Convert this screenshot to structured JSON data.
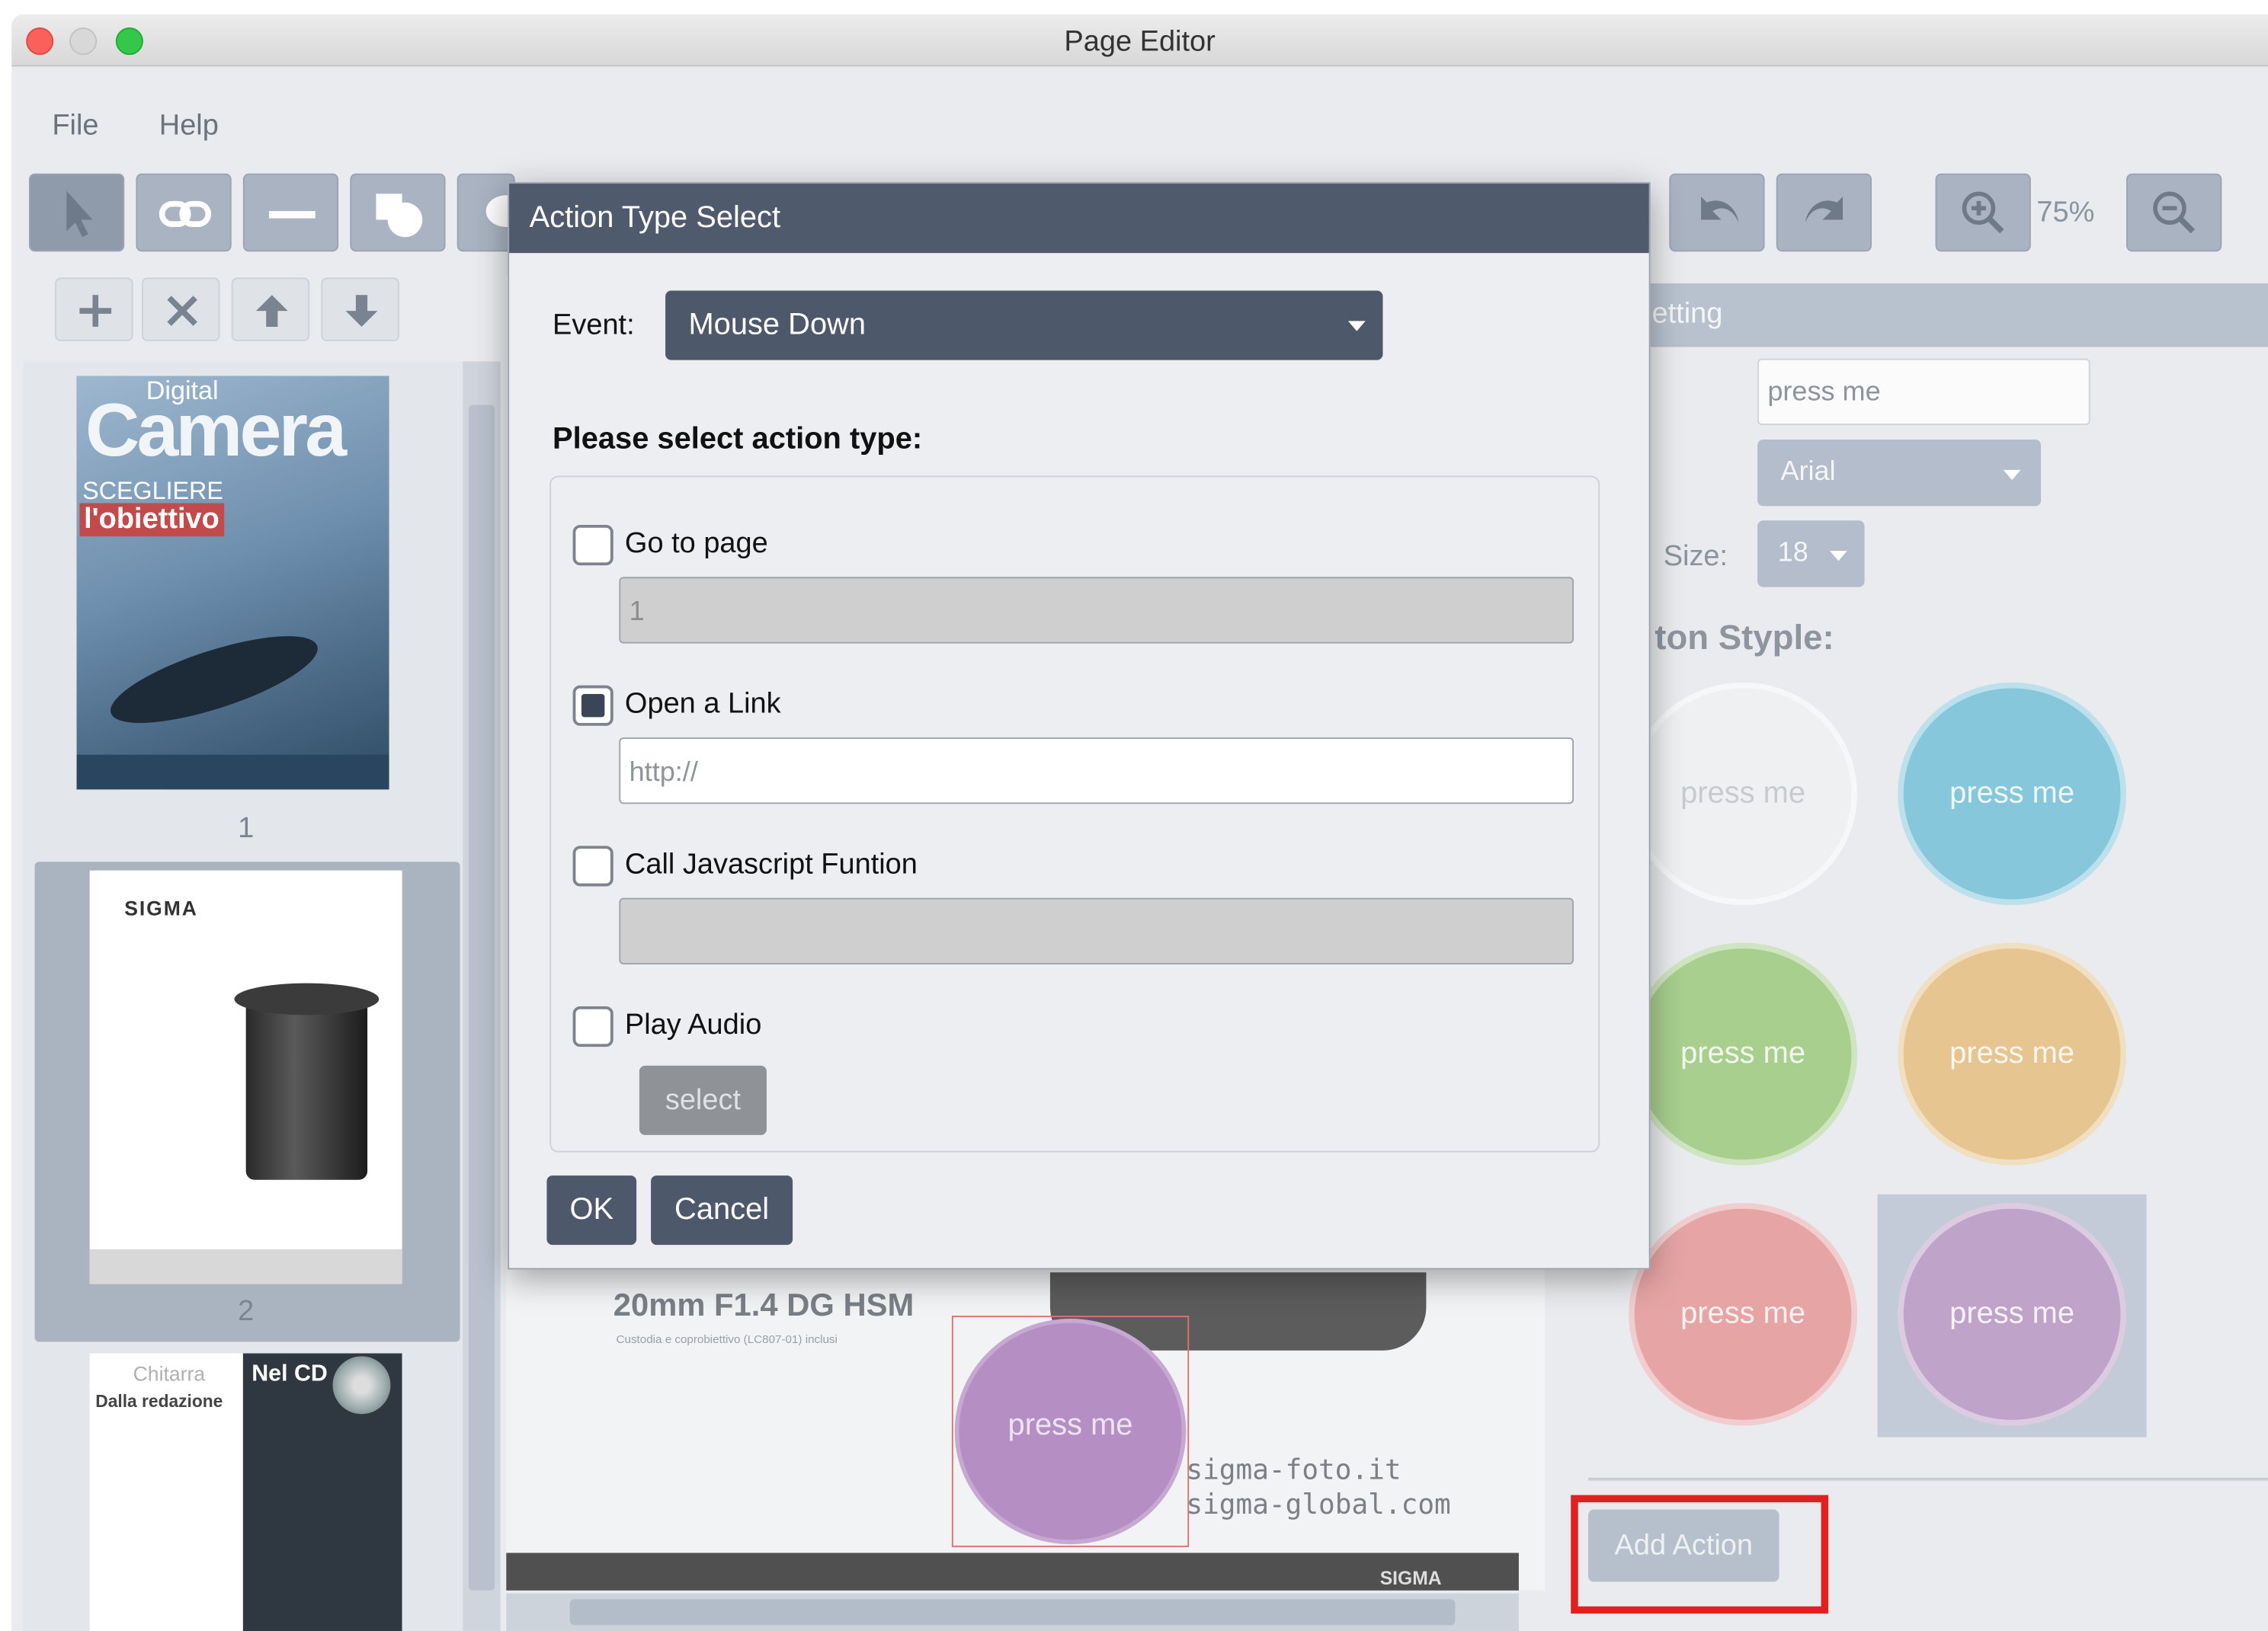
{
  "window": {
    "title": "Page Editor"
  },
  "menu": {
    "items": [
      "File",
      "Help"
    ]
  },
  "toolbar": {
    "zoom": "75%"
  },
  "pages": {
    "labels": [
      "1",
      "2"
    ],
    "page1": {
      "mag_title": "Camera",
      "mag_sub": "Digital",
      "headline1": "SCEGLIERE",
      "headline2": "l'obiettivo"
    },
    "page2": {
      "brand": "SIGMA"
    },
    "page3": {
      "left_title": "Chitarra",
      "left_sub": "Dalla redazione",
      "right_title": "Nel CD"
    }
  },
  "canvas": {
    "product": "20mm F1.4 DG HSM",
    "caption": "Custodia e coprobiettivo (LC807-01) inclusi",
    "button_text": "press me",
    "url1": "sigma-foto.it",
    "url2": "sigma-global.com",
    "footer_logo": "SIGMA"
  },
  "right_panel": {
    "header": "etting",
    "text_value": "press me",
    "font": "Arial",
    "size_label": "Size:",
    "size": "18",
    "style_heading": "ton Styple:",
    "style_items": [
      "press me",
      "press me",
      "press me",
      "press me",
      "press me",
      "press me"
    ],
    "style_colors": [
      "#eef0f2",
      "#86c7dc",
      "#a8cf8e",
      "#e6c590",
      "#e6a4a4",
      "#c0a3c9"
    ],
    "add_action": "Add Action"
  },
  "dialog": {
    "title": "Action Type Select",
    "event_label": "Event:",
    "event_value": "Mouse Down",
    "prompt": "Please select action type:",
    "options": [
      {
        "label": "Go to page",
        "checked": false,
        "field_value": "1"
      },
      {
        "label": "Open a Link",
        "checked": true,
        "field_placeholder": "http://"
      },
      {
        "label": "Call Javascript Funtion",
        "checked": false,
        "field_value": ""
      },
      {
        "label": "Play Audio",
        "checked": false,
        "button": "select"
      }
    ],
    "ok": "OK",
    "cancel": "Cancel"
  }
}
